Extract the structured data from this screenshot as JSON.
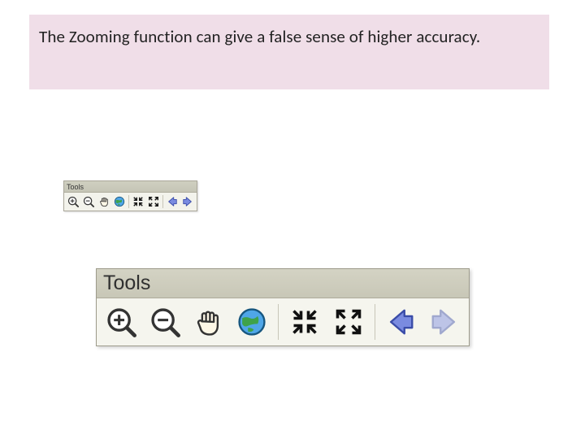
{
  "caption": "The Zooming function can give a false sense of higher accuracy.",
  "toolbar_small": {
    "title": "Tools",
    "buttons": [
      {
        "name": "zoom-in",
        "label": "Zoom In"
      },
      {
        "name": "zoom-out",
        "label": "Zoom Out"
      },
      {
        "name": "pan",
        "label": "Pan"
      },
      {
        "name": "full-extent",
        "label": "Full Extent"
      },
      {
        "name": "zoom-to-selection",
        "label": "Zoom To Selection"
      },
      {
        "name": "zoom-full",
        "label": "Zoom To Full"
      },
      {
        "name": "back",
        "label": "Back"
      },
      {
        "name": "forward",
        "label": "Forward"
      }
    ]
  },
  "toolbar_large": {
    "title": "Tools",
    "buttons": [
      {
        "name": "zoom-in",
        "label": "Zoom In"
      },
      {
        "name": "zoom-out",
        "label": "Zoom Out"
      },
      {
        "name": "pan",
        "label": "Pan"
      },
      {
        "name": "full-extent",
        "label": "Full Extent"
      },
      {
        "name": "zoom-to-selection",
        "label": "Zoom To Selection"
      },
      {
        "name": "zoom-full",
        "label": "Zoom To Full"
      },
      {
        "name": "back",
        "label": "Back"
      },
      {
        "name": "forward",
        "label": "Forward",
        "disabled": true
      }
    ]
  },
  "icons": {
    "zoom-in": "zoom-in-icon",
    "zoom-out": "zoom-out-icon",
    "pan": "hand-icon",
    "full-extent": "globe-icon",
    "zoom-to-selection": "arrows-in-icon",
    "zoom-full": "arrows-out-icon",
    "back": "arrow-left-icon",
    "forward": "arrow-right-icon"
  },
  "colors": {
    "caption_bg": "#f0dee8",
    "toolbar_title_bg": "#cfcfc0",
    "toolbar_body_bg": "#f5f5ee",
    "arrow_blue": "#5a6fd6",
    "globe_blue": "#2f7fd0",
    "globe_green": "#3fa24a"
  }
}
